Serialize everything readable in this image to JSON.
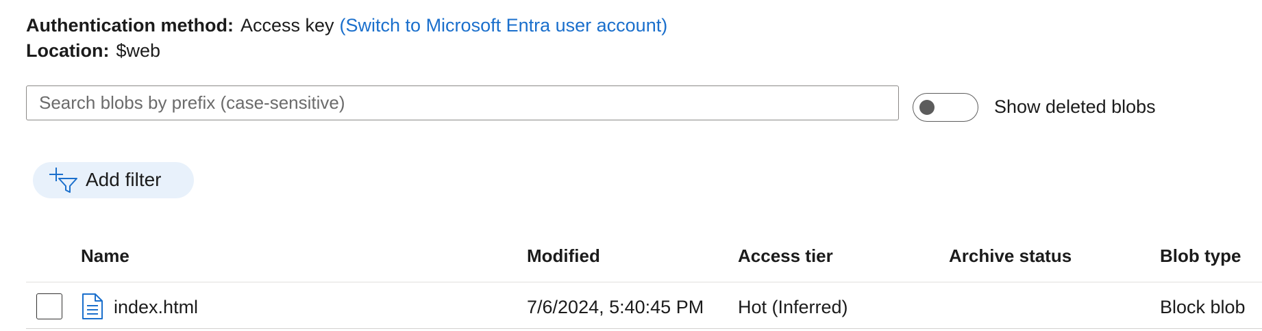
{
  "auth": {
    "label": "Authentication method:",
    "value": "Access key",
    "switch_link": "(Switch to Microsoft Entra user account)"
  },
  "location": {
    "label": "Location:",
    "value": "$web"
  },
  "search": {
    "placeholder": "Search blobs by prefix (case-sensitive)",
    "value": ""
  },
  "show_deleted": {
    "label": "Show deleted blobs",
    "enabled": false
  },
  "add_filter": {
    "label": "Add filter",
    "icon": "add-filter-icon"
  },
  "table": {
    "columns": [
      "Name",
      "Modified",
      "Access tier",
      "Archive status",
      "Blob type"
    ],
    "rows": [
      {
        "selected": false,
        "icon": "document-icon",
        "name": "index.html",
        "modified": "7/6/2024, 5:40:45 PM",
        "access_tier": "Hot (Inferred)",
        "archive_status": "",
        "blob_type": "Block blob"
      }
    ]
  },
  "colors": {
    "link": "#1a6fcc",
    "filter_bg": "#e8f1fb",
    "icon_blue": "#1a6fcc"
  }
}
